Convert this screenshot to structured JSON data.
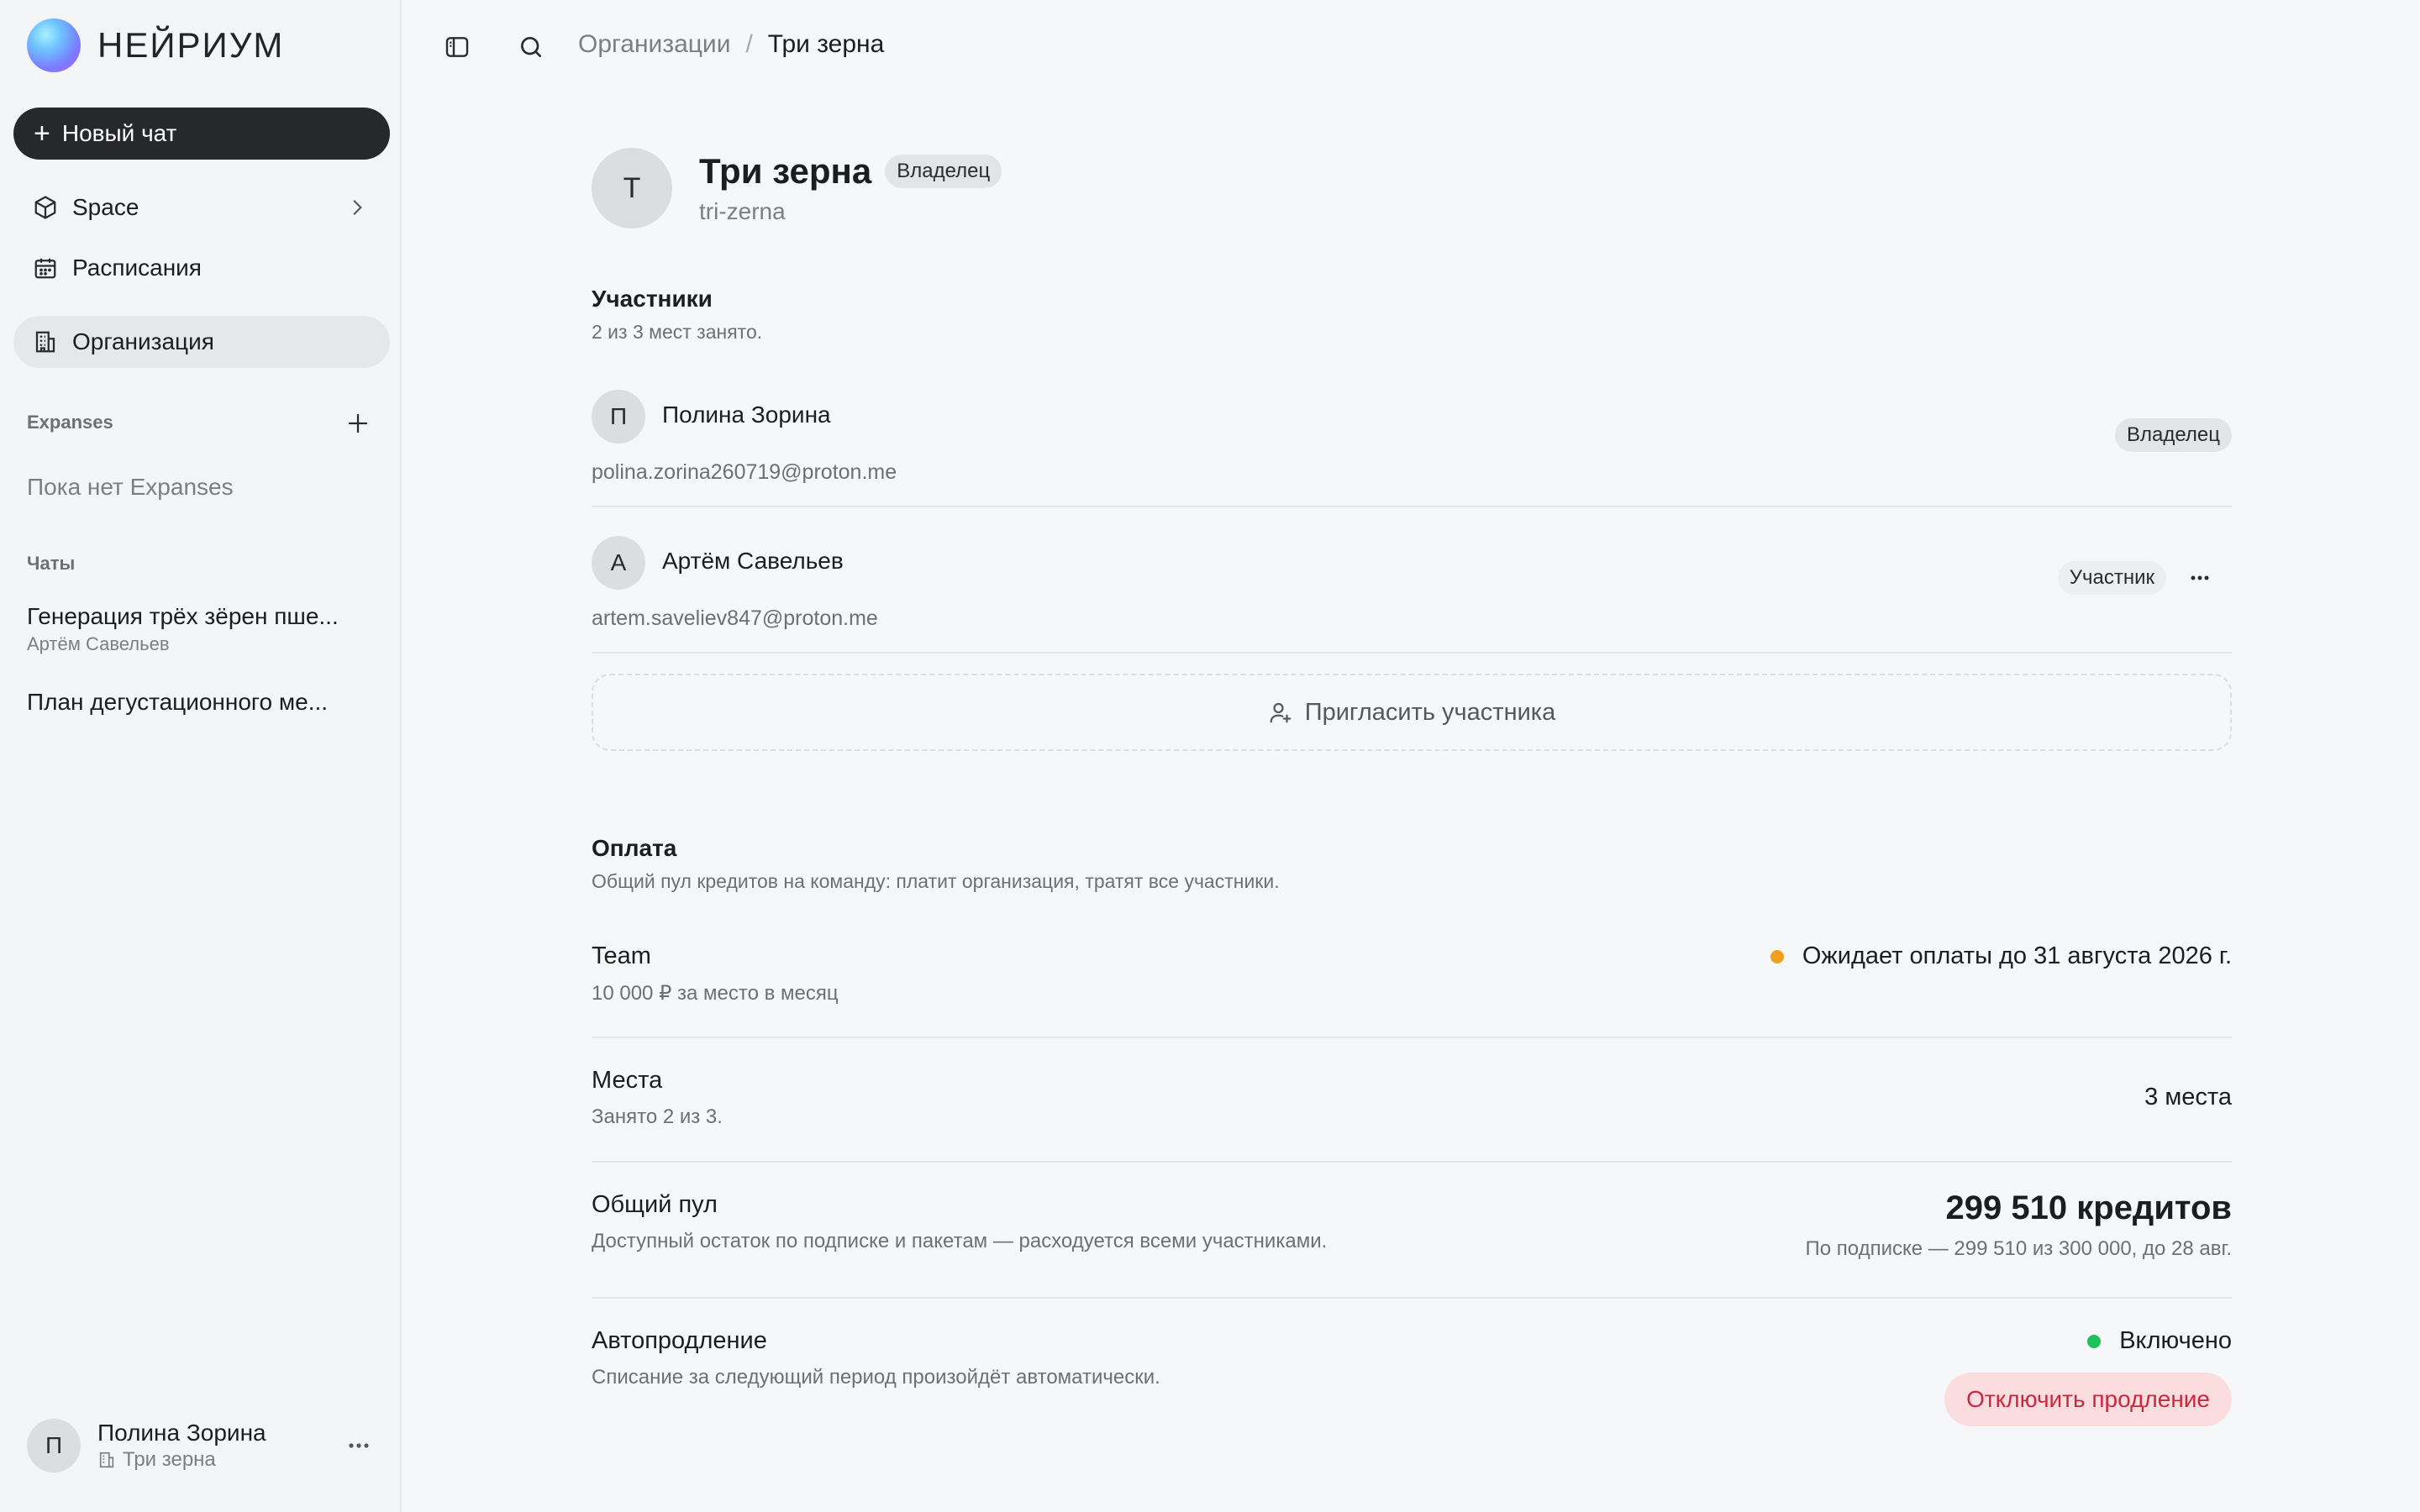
{
  "app": {
    "name": "НЕЙРИУМ"
  },
  "sidebar": {
    "new_chat_label": "Новый чат",
    "nav": [
      {
        "label": "Space",
        "icon": "cube-icon"
      },
      {
        "label": "Расписания",
        "icon": "calendar-icon"
      },
      {
        "label": "Организация",
        "icon": "building-icon",
        "active": true
      }
    ],
    "expanses_label": "Expanses",
    "expanses_empty": "Пока нет Expanses",
    "chats_label": "Чаты",
    "chats": [
      {
        "title": "Генерация трёх зёрен пше...",
        "subtitle": "Артём Савельев"
      },
      {
        "title": "План дегустационного ме...",
        "subtitle": ""
      }
    ],
    "user": {
      "initial": "П",
      "name": "Полина Зорина",
      "org": "Три зерна"
    }
  },
  "breadcrumb": {
    "parent": "Организации",
    "separator": "/",
    "current": "Три зерна"
  },
  "org": {
    "initial": "Т",
    "name": "Три зерна",
    "role_badge": "Владелец",
    "slug": "tri-zerna"
  },
  "members": {
    "title": "Участники",
    "subtitle": "2 из 3 мест занято.",
    "list": [
      {
        "initial": "П",
        "name": "Полина Зорина",
        "email": "polina.zorina260719@proton.me",
        "role": "Владелец"
      },
      {
        "initial": "А",
        "name": "Артём Савельев",
        "email": "artem.saveliev847@proton.me",
        "role": "Участник"
      }
    ],
    "invite_label": "Пригласить участника"
  },
  "billing": {
    "title": "Оплата",
    "subtitle": "Общий пул кредитов на команду: платит организация, тратят все участники.",
    "plan": {
      "name": "Team",
      "price": "10 000 ₽ за место в месяц",
      "status": "Ожидает оплаты до 31 августа 2026 г.",
      "status_color": "#f0a020"
    },
    "seats": {
      "name": "Места",
      "desc": "Занято 2 из 3.",
      "value": "3 места"
    },
    "pool": {
      "name": "Общий пул",
      "desc": "Доступный остаток по подписке и пакетам — расходуется всеми участниками.",
      "value": "299 510 кредитов",
      "detail": "По подписке — 299 510 из 300 000, до 28 авг."
    },
    "autorenew": {
      "name": "Автопродление",
      "desc": "Списание за следующий период произойдёт автоматически.",
      "status": "Включено",
      "status_color": "#1fc25a",
      "button": "Отключить продление"
    }
  }
}
